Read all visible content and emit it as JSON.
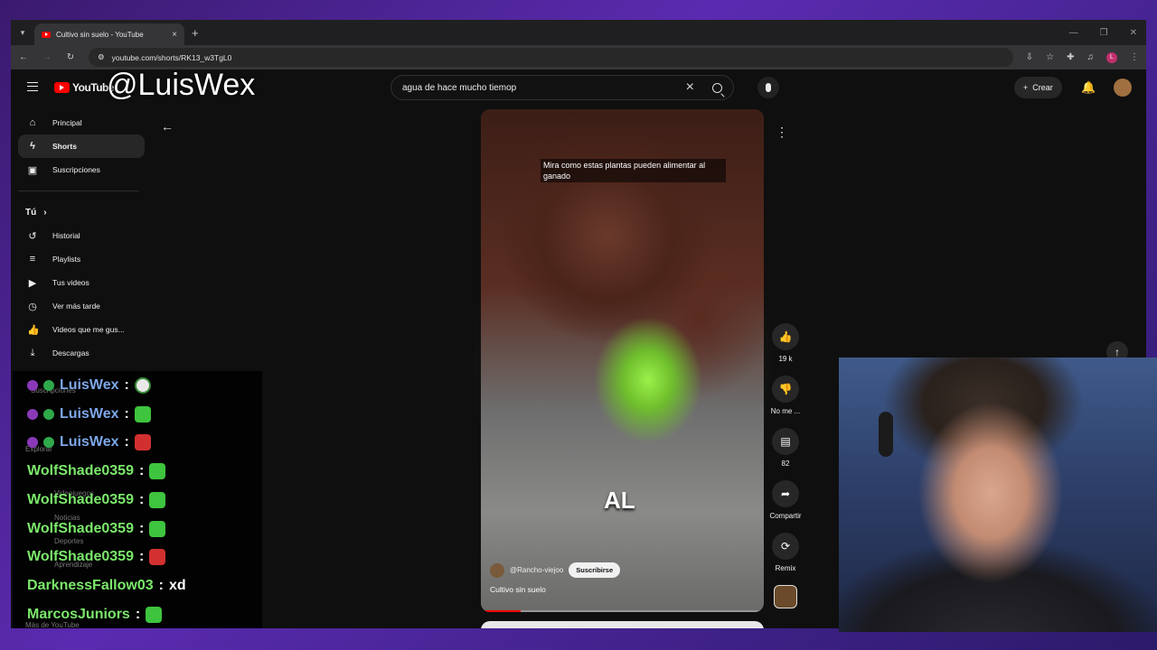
{
  "browser": {
    "tab_title": "Cultivo sin suelo - YouTube",
    "url": "youtube.com/shorts/RK13_w3TgL0",
    "profile_initial": "L"
  },
  "header": {
    "logo_text": "YouTube",
    "search_value": "agua de hace mucho tiemop",
    "create_label": "Crear"
  },
  "watermark": "@LuisWex",
  "sidebar": {
    "main": [
      {
        "label": "Principal",
        "icon": "home-icon"
      },
      {
        "label": "Shorts",
        "icon": "shorts-icon"
      },
      {
        "label": "Suscripciones",
        "icon": "subscriptions-icon"
      }
    ],
    "you_header": "Tú",
    "you_items": [
      {
        "label": "Historial",
        "icon": "history-icon"
      },
      {
        "label": "Playlists",
        "icon": "playlists-icon"
      },
      {
        "label": "Tus videos",
        "icon": "your-videos-icon"
      },
      {
        "label": "Ver más tarde",
        "icon": "watch-later-icon"
      },
      {
        "label": "Videos que me gus...",
        "icon": "liked-icon"
      },
      {
        "label": "Descargas",
        "icon": "downloads-icon"
      }
    ],
    "ghost_labels": [
      "Suscripciones",
      "Explorar",
      "Videojuegos",
      "Noticias",
      "Deportes",
      "Aprendizaje",
      "Más de YouTube"
    ]
  },
  "chat": [
    {
      "user": "LuisWex",
      "sep": " :",
      "msg": "",
      "color": "blue",
      "emote": "face"
    },
    {
      "user": "LuisWex",
      "sep": " :",
      "msg": "",
      "color": "blue",
      "emote": "green"
    },
    {
      "user": "LuisWex",
      "sep": " :",
      "msg": "",
      "color": "blue",
      "emote": "red"
    },
    {
      "user": "WolfShade0359",
      "sep": " :",
      "msg": "",
      "color": "green",
      "emote": "green"
    },
    {
      "user": "WolfShade0359",
      "sep": " :",
      "msg": "",
      "color": "green",
      "emote": "green"
    },
    {
      "user": "WolfShade0359",
      "sep": " :",
      "msg": "",
      "color": "green",
      "emote": "green"
    },
    {
      "user": "WolfShade0359",
      "sep": " :",
      "msg": "",
      "color": "green",
      "emote": "red"
    },
    {
      "user": "DarknessFallow03",
      "sep": " :",
      "msg": "xd",
      "color": "green",
      "emote": ""
    },
    {
      "user": "MarcosJuniors",
      "sep": " :",
      "msg": "",
      "color": "green",
      "emote": "green"
    }
  ],
  "video": {
    "caption": "Mira como estas plantas pueden alimentar al ganado",
    "overlay_word": "AL",
    "channel": "@Rancho-viejoo",
    "subscribe_label": "Suscribirse",
    "title": "Cultivo sin suelo",
    "progress": 0.14
  },
  "actions": {
    "like_count": "19 k",
    "dislike_label": "No me ...",
    "comments_count": "82",
    "share_label": "Compartir",
    "remix_label": "Remix"
  }
}
